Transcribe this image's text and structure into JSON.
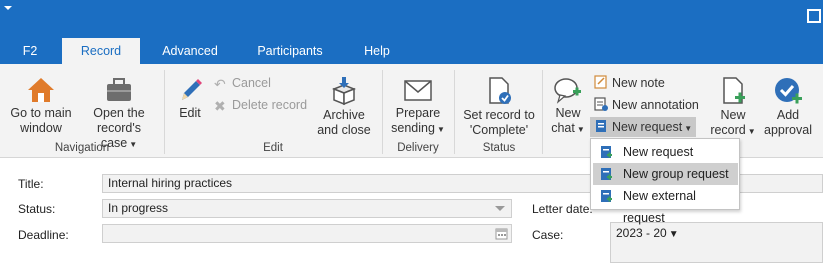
{
  "tabs": [
    {
      "label": "F2",
      "active": false
    },
    {
      "label": "Record",
      "active": true
    },
    {
      "label": "Advanced",
      "active": false
    },
    {
      "label": "Participants",
      "active": false
    },
    {
      "label": "Help",
      "active": false
    }
  ],
  "ribbon": {
    "navigation": {
      "label": "Navigation",
      "go_main_line1": "Go to main",
      "go_main_line2": "window",
      "open_case_line1": "Open the",
      "open_case_line2": "record's case"
    },
    "edit": {
      "label": "Edit",
      "edit": "Edit",
      "cancel": "Cancel",
      "delete_record": "Delete record",
      "archive_line1": "Archive",
      "archive_line2": "and close"
    },
    "delivery": {
      "label": "Delivery",
      "prepare_line1": "Prepare",
      "prepare_line2": "sending"
    },
    "status": {
      "label": "Status",
      "set_line1": "Set record to",
      "set_line2": "'Complete'"
    },
    "new": {
      "new_chat_line1": "New",
      "new_chat_line2": "chat",
      "new_note": "New note",
      "new_annotation": "New annotation",
      "new_request": "New request",
      "new_record_line1": "New",
      "new_record_line2": "record",
      "add_approval_line1": "Add",
      "add_approval_line2": "approval"
    }
  },
  "dropdown": {
    "items": [
      "New request",
      "New group request",
      "New external request"
    ],
    "highlighted": 1
  },
  "form": {
    "title_label": "Title:",
    "title_value": "Internal hiring practices",
    "status_label": "Status:",
    "status_value": "In progress",
    "deadline_label": "Deadline:",
    "deadline_value": "",
    "letter_date_label": "Letter date:",
    "case_label": "Case:",
    "case_value": "2023 - 20"
  },
  "colors": {
    "accent": "#1b6ec2",
    "ribbon_bg": "#f3f3f3",
    "highlight": "#cfcfcf"
  }
}
